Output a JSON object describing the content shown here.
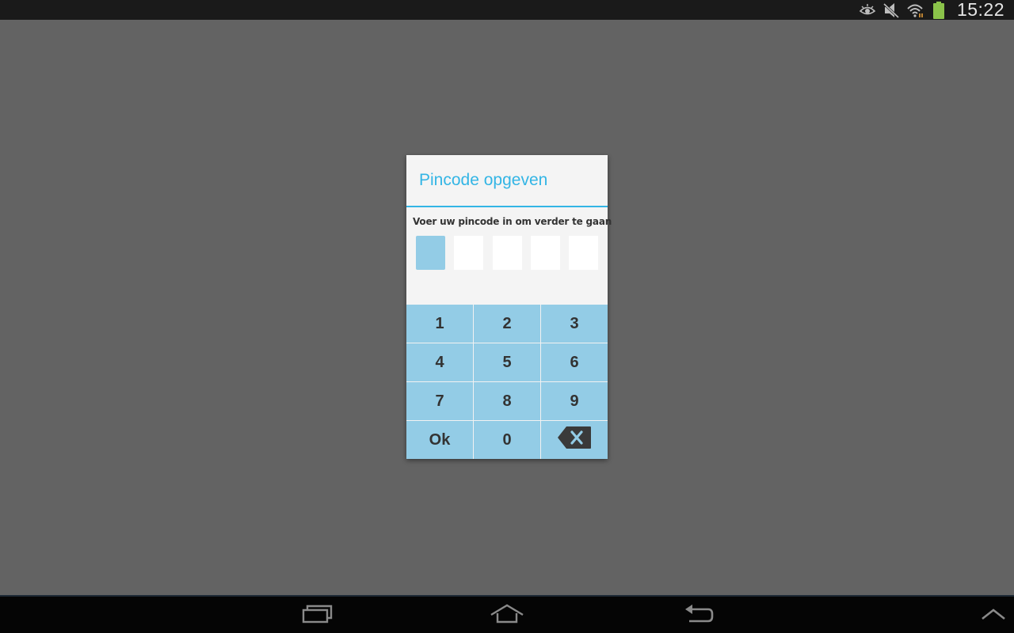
{
  "status_bar": {
    "time": "15:22",
    "icons": [
      "smart-stay-eye-icon",
      "muted-notifications-icon",
      "wifi-icon",
      "battery-icon"
    ],
    "battery_color": "#8bc34a"
  },
  "dialog": {
    "title": "Pincode opgeven",
    "prompt": "Voer uw pincode in om verder te gaan",
    "pin_length": 5,
    "active_pin_index": 0,
    "accent_color": "#33b5e5",
    "keypad_color": "#93cce6"
  },
  "keypad": {
    "keys": [
      "1",
      "2",
      "3",
      "4",
      "5",
      "6",
      "7",
      "8",
      "9",
      "Ok",
      "0"
    ],
    "backspace_icon": "backspace-icon"
  },
  "nav_bar": {
    "buttons": [
      "recent-apps-icon",
      "home-icon",
      "back-icon",
      "menu-up-icon"
    ]
  }
}
